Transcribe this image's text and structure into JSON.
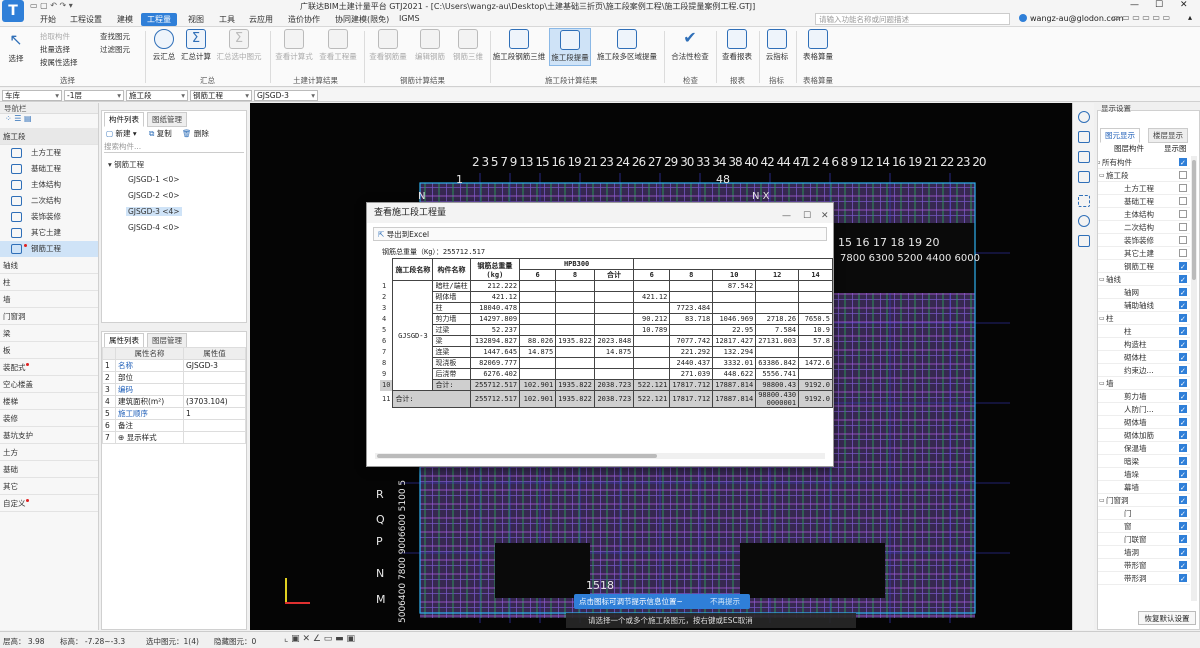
{
  "titlebar": {
    "title": "广联达BIM土建计量平台 GTJ2021 - [C:\\Users\\wangz-au\\Desktop\\土建基础三折页\\施工段案例工程\\施工段提量案例工程.GTJ]",
    "search_placeholder": "请输入功能名称或问题描述",
    "user": "wangz-au@glodon.com"
  },
  "menu": [
    "开始",
    "工程设置",
    "建模",
    "工程量",
    "视图",
    "工具",
    "云应用",
    "造价协作",
    "协同建模(限免)",
    "IGMS"
  ],
  "menu_active_index": 3,
  "ribbon": {
    "select_group": {
      "label": "选择",
      "big": "选择",
      "items": [
        "拾取构件",
        "批量选择",
        "按属性选择",
        "查找图元",
        "过滤图元"
      ]
    },
    "summary_group": {
      "label": "汇总",
      "items": [
        "云汇总",
        "汇总计算",
        "汇总选中图元"
      ]
    },
    "civil_group": {
      "label": "土建计算结果",
      "items": [
        "查看计算式",
        "查看工程量"
      ]
    },
    "rebar_group": {
      "label": "钢筋计算结果",
      "items": [
        "查看钢筋量",
        "编辑钢筋",
        "钢筋三维"
      ]
    },
    "stage_group": {
      "label": "施工段计算结果",
      "items": [
        "施工段钢筋三维",
        "施工段提量",
        "施工段多区域提量"
      ]
    },
    "check_group": {
      "label": "检查",
      "items": [
        "合法性检查"
      ]
    },
    "report_group": {
      "label": "报表",
      "items": [
        "查看报表"
      ]
    },
    "index_group": {
      "label": "指标",
      "items": [
        "云指标"
      ]
    },
    "calc_group": {
      "label": "表格算量",
      "items": [
        "表格算量"
      ]
    }
  },
  "selectors": [
    "车库",
    "-1层",
    "施工段",
    "钢筋工程",
    "GJSGD-3"
  ],
  "nav": {
    "title": "导航栏",
    "main_section": "施工段",
    "items": [
      "土方工程",
      "基础工程",
      "主体结构",
      "二次结构",
      "装饰装修",
      "其它土建",
      "钢筋工程"
    ],
    "sections": [
      "轴线",
      "柱",
      "墙",
      "门窗洞",
      "梁",
      "板",
      "装配式",
      "空心楼盖",
      "楼梯",
      "装修",
      "基坑支护",
      "土方",
      "基础",
      "其它",
      "自定义"
    ]
  },
  "complist": {
    "tabs": [
      "构件列表",
      "图纸管理"
    ],
    "actions": [
      "新建",
      "复制",
      "删除"
    ],
    "search_placeholder": "搜索构件...",
    "root": "钢筋工程",
    "items": [
      "GJSGD-1 <0>",
      "GJSGD-2 <0>",
      "GJSGD-3 <4>",
      "GJSGD-4 <0>"
    ]
  },
  "proplist": {
    "tabs": [
      "属性列表",
      "图层管理"
    ],
    "headers": [
      "属性名称",
      "属性值"
    ],
    "rows": [
      {
        "n": "1",
        "name": "名称",
        "value": "GJSGD-3"
      },
      {
        "n": "2",
        "name": "部位",
        "value": ""
      },
      {
        "n": "3",
        "name": "编码",
        "value": ""
      },
      {
        "n": "4",
        "name": "建筑面积(m²)",
        "value": "(3703.104)"
      },
      {
        "n": "5",
        "name": "施工顺序",
        "value": "1"
      },
      {
        "n": "6",
        "name": "备注",
        "value": ""
      },
      {
        "n": "7",
        "name": "显示样式",
        "value": ""
      }
    ]
  },
  "dialog": {
    "title": "查看施工段工程量",
    "export": "导出到Excel",
    "total_label": "钢筋总重量（Kg）：255712.517",
    "header": {
      "stage": "施工段名称",
      "component": "构件名称",
      "total": "钢筋总重量(kg)",
      "hpb": "HPB300",
      "cols": [
        "6",
        "8",
        "合计",
        "6",
        "8",
        "10",
        "12",
        "14"
      ]
    },
    "stage_name": "GJSGD-3",
    "rows": [
      {
        "n": "1",
        "name": "暗柱/端柱",
        "total": "212.222",
        "c": [
          "",
          "",
          "",
          "",
          "",
          "87.542",
          "",
          ""
        ]
      },
      {
        "n": "2",
        "name": "砌体墙",
        "total": "421.12",
        "c": [
          "",
          "",
          "",
          "421.12",
          "",
          "",
          "",
          ""
        ]
      },
      {
        "n": "3",
        "name": "柱",
        "total": "18040.478",
        "c": [
          "",
          "",
          "",
          "",
          "7723.484",
          "",
          "",
          ""
        ]
      },
      {
        "n": "4",
        "name": "剪力墙",
        "total": "14297.809",
        "c": [
          "",
          "",
          "",
          "90.212",
          "83.718",
          "1046.969",
          "2718.26",
          "7650.5"
        ]
      },
      {
        "n": "5",
        "name": "过梁",
        "total": "52.237",
        "c": [
          "",
          "",
          "",
          "10.789",
          "",
          "22.95",
          "7.584",
          "10.9"
        ]
      },
      {
        "n": "6",
        "name": "梁",
        "total": "132894.827",
        "c": [
          "88.026",
          "1935.822",
          "2023.848",
          "",
          "7077.742",
          "12817.427",
          "27131.003",
          "57.8"
        ]
      },
      {
        "n": "7",
        "name": "连梁",
        "total": "1447.645",
        "c": [
          "14.875",
          "",
          "14.875",
          "",
          "221.292",
          "132.294",
          "",
          ""
        ]
      },
      {
        "n": "8",
        "name": "现浇板",
        "total": "82069.777",
        "c": [
          "",
          "",
          "",
          "",
          "2440.437",
          "3332.01",
          "63386.842",
          "1472.6"
        ]
      },
      {
        "n": "9",
        "name": "后浇带",
        "total": "6276.402",
        "c": [
          "",
          "",
          "",
          "",
          "271.039",
          "448.622",
          "5556.741",
          ""
        ]
      },
      {
        "n": "10",
        "name": "合计:",
        "total": "255712.517",
        "c": [
          "102.901",
          "1935.822",
          "2038.723",
          "522.121",
          "17817.712",
          "17887.814",
          "98800.43",
          "9192.0"
        ]
      }
    ],
    "grand": {
      "n": "11",
      "name": "合计:",
      "total": "255712.517",
      "c": [
        "102.901",
        "1935.822",
        "2038.723",
        "522.121",
        "17817.712",
        "17887.814",
        "98800.4300000001",
        "9192.0"
      ]
    }
  },
  "canvas": {
    "top_axis_left": "2 3  5  7 9   13 15 16 19 21 23 24 26 27 29 30 33 34 38 40 42   44 47",
    "top_axis_right": "1  2  4  6   8  9 12 14 16 19 21 22 23 20",
    "label_1": "1",
    "label_48": "48",
    "label_N": "N",
    "label_NX": "N   X",
    "row_labels": [
      "R",
      "Q",
      "P",
      "N",
      "M"
    ],
    "bottom_label": "1518",
    "right_labels": "15  16  17  18 19 20",
    "right_dims": "7800 6300 5200 4400 6000",
    "left_dims": "5006400 7800 9006600 5100 5",
    "toast": "点击图标可调节提示信息位置~",
    "toast_dismiss": "不再提示",
    "hint": "请选择一个或多个施工段图元，按右键或ESC取消"
  },
  "display": {
    "title": "显示设置",
    "tabs": [
      "图元显示",
      "楼层显示"
    ],
    "headers": [
      "图层构件",
      "显示图"
    ],
    "rows": [
      {
        "label": "所有构件",
        "lvl": 0,
        "on": true
      },
      {
        "label": "施工段",
        "lvl": 1,
        "on": false
      },
      {
        "label": "土方工程",
        "lvl": 2,
        "on": false
      },
      {
        "label": "基础工程",
        "lvl": 2,
        "on": false
      },
      {
        "label": "主体结构",
        "lvl": 2,
        "on": false
      },
      {
        "label": "二次结构",
        "lvl": 2,
        "on": false
      },
      {
        "label": "装饰装修",
        "lvl": 2,
        "on": false
      },
      {
        "label": "其它土建",
        "lvl": 2,
        "on": false
      },
      {
        "label": "钢筋工程",
        "lvl": 2,
        "on": true
      },
      {
        "label": "轴线",
        "lvl": 1,
        "on": true
      },
      {
        "label": "轴网",
        "lvl": 2,
        "on": true
      },
      {
        "label": "辅助轴线",
        "lvl": 2,
        "on": true
      },
      {
        "label": "柱",
        "lvl": 1,
        "on": true
      },
      {
        "label": "柱",
        "lvl": 2,
        "on": true
      },
      {
        "label": "构造柱",
        "lvl": 2,
        "on": true
      },
      {
        "label": "砌体柱",
        "lvl": 2,
        "on": true
      },
      {
        "label": "约束边...",
        "lvl": 2,
        "on": true
      },
      {
        "label": "墙",
        "lvl": 1,
        "on": true
      },
      {
        "label": "剪力墙",
        "lvl": 2,
        "on": true
      },
      {
        "label": "人防门...",
        "lvl": 2,
        "on": true
      },
      {
        "label": "砌体墙",
        "lvl": 2,
        "on": true
      },
      {
        "label": "砌体加筋",
        "lvl": 2,
        "on": true
      },
      {
        "label": "保温墙",
        "lvl": 2,
        "on": true
      },
      {
        "label": "暗梁",
        "lvl": 2,
        "on": true
      },
      {
        "label": "墙垛",
        "lvl": 2,
        "on": true
      },
      {
        "label": "幕墙",
        "lvl": 2,
        "on": true
      },
      {
        "label": "门窗洞",
        "lvl": 1,
        "on": true
      },
      {
        "label": "门",
        "lvl": 2,
        "on": true
      },
      {
        "label": "窗",
        "lvl": 2,
        "on": true
      },
      {
        "label": "门联窗",
        "lvl": 2,
        "on": true
      },
      {
        "label": "墙洞",
        "lvl": 2,
        "on": true
      },
      {
        "label": "带形窗",
        "lvl": 2,
        "on": true
      },
      {
        "label": "带形洞",
        "lvl": 2,
        "on": true
      }
    ],
    "restore": "恢复默认设置"
  },
  "status": {
    "floor_height": "层高：  3.98",
    "elevation": "标高：  -7.28~-3.3",
    "selected": "选中图元：1(4)",
    "hidden": "隐藏图元：0"
  }
}
